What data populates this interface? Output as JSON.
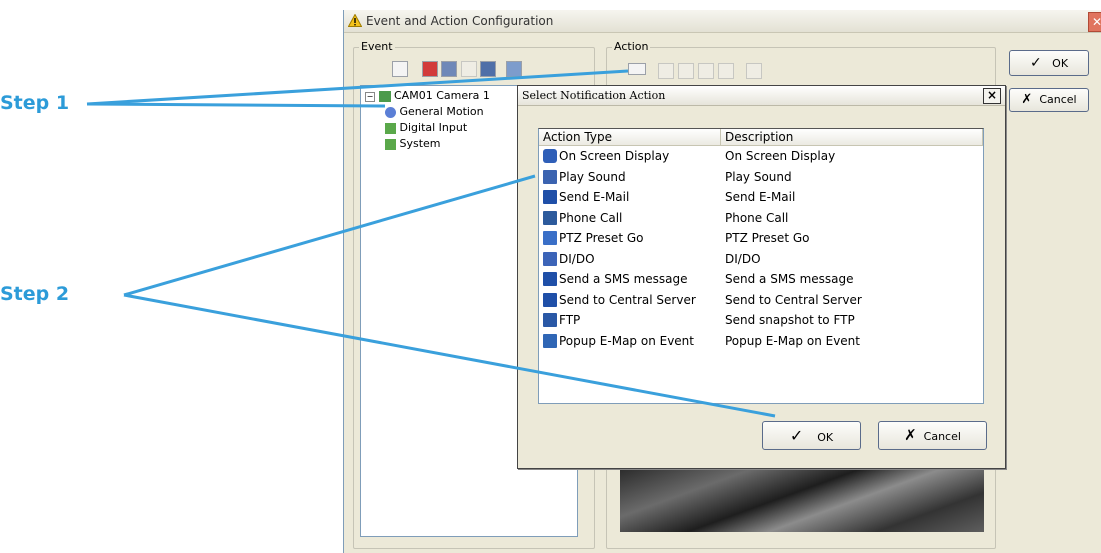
{
  "annotations": {
    "step1": "Step 1",
    "step2": "Step 2",
    "line_color": "#3aa0dc"
  },
  "window": {
    "title": "Event and Action Configuration",
    "icon": "warning-icon",
    "event_group_label": "Event",
    "action_group_label": "Action",
    "ok_label": "OK",
    "cancel_label": "Cancel"
  },
  "event_tree": {
    "items": [
      {
        "label": "CAM01 Camera 1",
        "icon": "camera-icon",
        "expanded": true
      },
      {
        "label": "General Motion",
        "icon": "motion-icon",
        "child": true
      },
      {
        "label": "Digital Input",
        "icon": "plugin-icon"
      },
      {
        "label": "System",
        "icon": "plugin-icon"
      }
    ]
  },
  "dialog": {
    "title": "Select Notification Action",
    "columns": [
      "Action Type",
      "Description"
    ],
    "rows": [
      {
        "type": "On Screen Display",
        "desc": "On Screen Display",
        "icon": "screen-display-icon"
      },
      {
        "type": "Play Sound",
        "desc": "Play Sound",
        "icon": "speaker-icon"
      },
      {
        "type": "Send E-Mail",
        "desc": "Send E-Mail",
        "icon": "mail-icon"
      },
      {
        "type": "Phone Call",
        "desc": "Phone Call",
        "icon": "phone-icon"
      },
      {
        "type": "PTZ Preset Go",
        "desc": "PTZ Preset Go",
        "icon": "ptz-arrows-icon"
      },
      {
        "type": "DI/DO",
        "desc": "DI/DO",
        "icon": "dido-icon"
      },
      {
        "type": "Send a SMS message",
        "desc": "Send a SMS message",
        "icon": "mail-icon"
      },
      {
        "type": "Send to Central Server",
        "desc": "Send to Central Server",
        "icon": "mail-icon"
      },
      {
        "type": "FTP",
        "desc": "Send snapshot to FTP",
        "icon": "ftp-upload-icon"
      },
      {
        "type": "Popup E-Map on Event",
        "desc": "Popup E-Map on Event",
        "icon": "emap-compass-icon"
      }
    ],
    "ok_label": "OK",
    "cancel_label": "Cancel"
  }
}
